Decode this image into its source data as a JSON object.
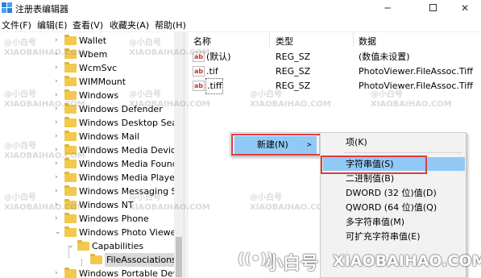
{
  "window": {
    "title": "注册表编辑器",
    "controls": {
      "minimize": "─",
      "maximize": "",
      "close": "✕"
    }
  },
  "menu": [
    "文件(F)",
    "编辑(E)",
    "查看(V)",
    "收藏夹(A)",
    "帮助(H)"
  ],
  "tree": {
    "items": [
      {
        "label": "Wallet",
        "expanded": false
      },
      {
        "label": "Wbem",
        "expanded": false
      },
      {
        "label": "WcmSvc",
        "expanded": false
      },
      {
        "label": "WIMMount",
        "expanded": false
      },
      {
        "label": "Windows",
        "expanded": false
      },
      {
        "label": "Windows Defender",
        "expanded": false
      },
      {
        "label": "Windows Desktop Sear",
        "expanded": false
      },
      {
        "label": "Windows Mail",
        "expanded": false
      },
      {
        "label": "Windows Media Device",
        "expanded": false
      },
      {
        "label": "Windows Media Founda",
        "expanded": false
      },
      {
        "label": "Windows Media Player",
        "expanded": false
      },
      {
        "label": "Windows Messaging Su",
        "expanded": false
      },
      {
        "label": "Windows NT",
        "expanded": false
      },
      {
        "label": "Windows Phone",
        "expanded": false
      },
      {
        "label": "Windows Photo Viewer",
        "expanded": true
      },
      {
        "label": "Capabilities",
        "expanded": true
      },
      {
        "label": "FileAssociations",
        "selected": true
      },
      {
        "label": "Windows Portable Devi",
        "expanded": false
      }
    ]
  },
  "values": {
    "columns": [
      "名称",
      "类型",
      "数据"
    ],
    "rows": [
      {
        "icon": "ab",
        "name": "(默认)",
        "type": "REG_SZ",
        "data": "(数值未设置)"
      },
      {
        "icon": "ab",
        "name": ".tif",
        "type": "REG_SZ",
        "data": "PhotoViewer.FileAssoc.Tiff"
      },
      {
        "icon": "ab",
        "name": ".tiff",
        "type": "REG_SZ",
        "data": "PhotoViewer.FileAssoc.Tiff"
      }
    ]
  },
  "context_menu": {
    "new_label": "新建(N)",
    "new_arrow": ">",
    "submenu": {
      "key": "项(K)",
      "items": [
        "字符串值(S)",
        "二进制值(B)",
        "DWORD (32 位)值(D)",
        "QWORD (64 位)值(Q)",
        "多字符串值(M)",
        "可扩充字符串值(E)"
      ],
      "hover_index": 0
    }
  },
  "highlight_color": "#e23b3b",
  "selection_color": "#91c9f7",
  "watermark": {
    "repeat_cn": "@小白号",
    "repeat_en": "XIAOBAIHAO.COM",
    "brand_icon": "((•))",
    "brand_cn": "小白号",
    "brand_en": "XIAOBAIHAO.COM"
  }
}
